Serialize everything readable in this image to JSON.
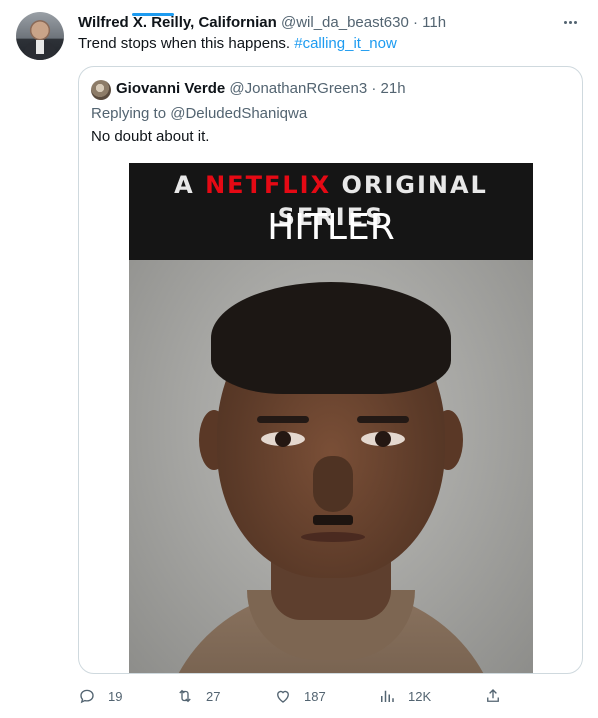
{
  "tweet": {
    "author_name": "Wilfred X. Reilly, Californian",
    "author_handle": "@wil_da_beast630",
    "dot": "·",
    "time": "11h",
    "text": "Trend stops when this happens.",
    "hashtag": "#calling_it_now"
  },
  "quote": {
    "author_name": "Giovanni Verde",
    "author_handle": "@JonathanRGreen3",
    "dot": "·",
    "time": "21h",
    "replying_prefix": "Replying to",
    "replying_to": "@DeludedShaniqwa",
    "text": "No doubt about it.",
    "image": {
      "prefix": "A",
      "brand": "NETFLIX",
      "suffix": "ORIGINAL SERIES",
      "title": "HITLER",
      "brand_color": "#e50914"
    }
  },
  "actions": {
    "reply": {
      "icon": "reply-icon",
      "count": "19"
    },
    "retweet": {
      "icon": "retweet-icon",
      "count": "27"
    },
    "like": {
      "icon": "heart-icon",
      "count": "187"
    },
    "views": {
      "icon": "views-icon",
      "count": "12K"
    },
    "share": {
      "icon": "share-icon"
    }
  },
  "colors": {
    "accent": "#1d9bf0",
    "muted_text": "#536471",
    "border": "#cfd9de"
  }
}
